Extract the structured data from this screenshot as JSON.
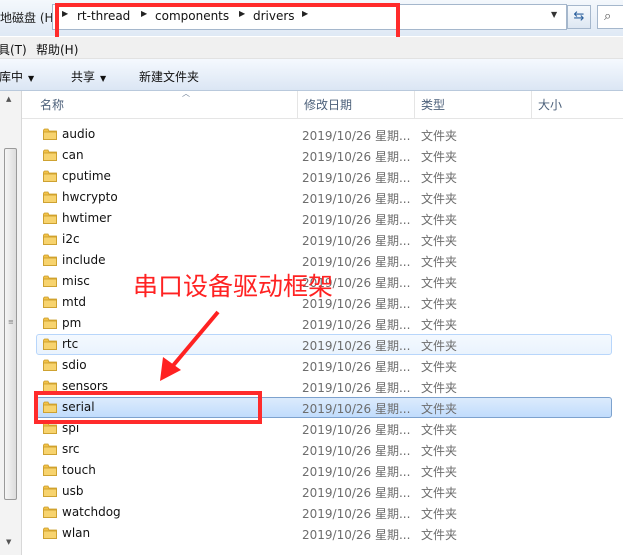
{
  "address_bar": {
    "drive_label": "地磁盘 (H:)",
    "breadcrumbs": [
      "rt-thread",
      "components",
      "drivers"
    ],
    "search_icon_glyph": "⌕",
    "refresh_icon_glyph": "⇆"
  },
  "menu": {
    "items": [
      "具(T)",
      "帮助(H)"
    ]
  },
  "toolbar": {
    "items": [
      "库中",
      "共享",
      "新建文件夹"
    ]
  },
  "columns": {
    "name": "名称",
    "date": "修改日期",
    "type": "类型",
    "size": "大小"
  },
  "files": [
    {
      "name": "audio",
      "date": "2019/10/26 星期...",
      "type": "文件夹",
      "state": "normal"
    },
    {
      "name": "can",
      "date": "2019/10/26 星期...",
      "type": "文件夹",
      "state": "normal"
    },
    {
      "name": "cputime",
      "date": "2019/10/26 星期...",
      "type": "文件夹",
      "state": "normal"
    },
    {
      "name": "hwcrypto",
      "date": "2019/10/26 星期...",
      "type": "文件夹",
      "state": "normal"
    },
    {
      "name": "hwtimer",
      "date": "2019/10/26 星期...",
      "type": "文件夹",
      "state": "normal"
    },
    {
      "name": "i2c",
      "date": "2019/10/26 星期...",
      "type": "文件夹",
      "state": "normal"
    },
    {
      "name": "include",
      "date": "2019/10/26 星期...",
      "type": "文件夹",
      "state": "normal"
    },
    {
      "name": "misc",
      "date": "2019/10/26 星期...",
      "type": "文件夹",
      "state": "normal"
    },
    {
      "name": "mtd",
      "date": "2019/10/26 星期...",
      "type": "文件夹",
      "state": "normal"
    },
    {
      "name": "pm",
      "date": "2019/10/26 星期...",
      "type": "文件夹",
      "state": "normal"
    },
    {
      "name": "rtc",
      "date": "2019/10/26 星期...",
      "type": "文件夹",
      "state": "hover"
    },
    {
      "name": "sdio",
      "date": "2019/10/26 星期...",
      "type": "文件夹",
      "state": "normal"
    },
    {
      "name": "sensors",
      "date": "2019/10/26 星期...",
      "type": "文件夹",
      "state": "normal"
    },
    {
      "name": "serial",
      "date": "2019/10/26 星期...",
      "type": "文件夹",
      "state": "selected"
    },
    {
      "name": "spi",
      "date": "2019/10/26 星期...",
      "type": "文件夹",
      "state": "normal"
    },
    {
      "name": "src",
      "date": "2019/10/26 星期...",
      "type": "文件夹",
      "state": "normal"
    },
    {
      "name": "touch",
      "date": "2019/10/26 星期...",
      "type": "文件夹",
      "state": "normal"
    },
    {
      "name": "usb",
      "date": "2019/10/26 星期...",
      "type": "文件夹",
      "state": "normal"
    },
    {
      "name": "watchdog",
      "date": "2019/10/26 星期...",
      "type": "文件夹",
      "state": "normal"
    },
    {
      "name": "wlan",
      "date": "2019/10/26 星期...",
      "type": "文件夹",
      "state": "normal"
    }
  ],
  "annotation": {
    "text": "串口设备驱动框架",
    "color": "#ff2222"
  },
  "colors": {
    "highlight_red": "#ff2b2b",
    "selected_row": "#c1dcfc",
    "hover_row": "#eaf3fd",
    "folder_yellow": "#f2c24a"
  }
}
